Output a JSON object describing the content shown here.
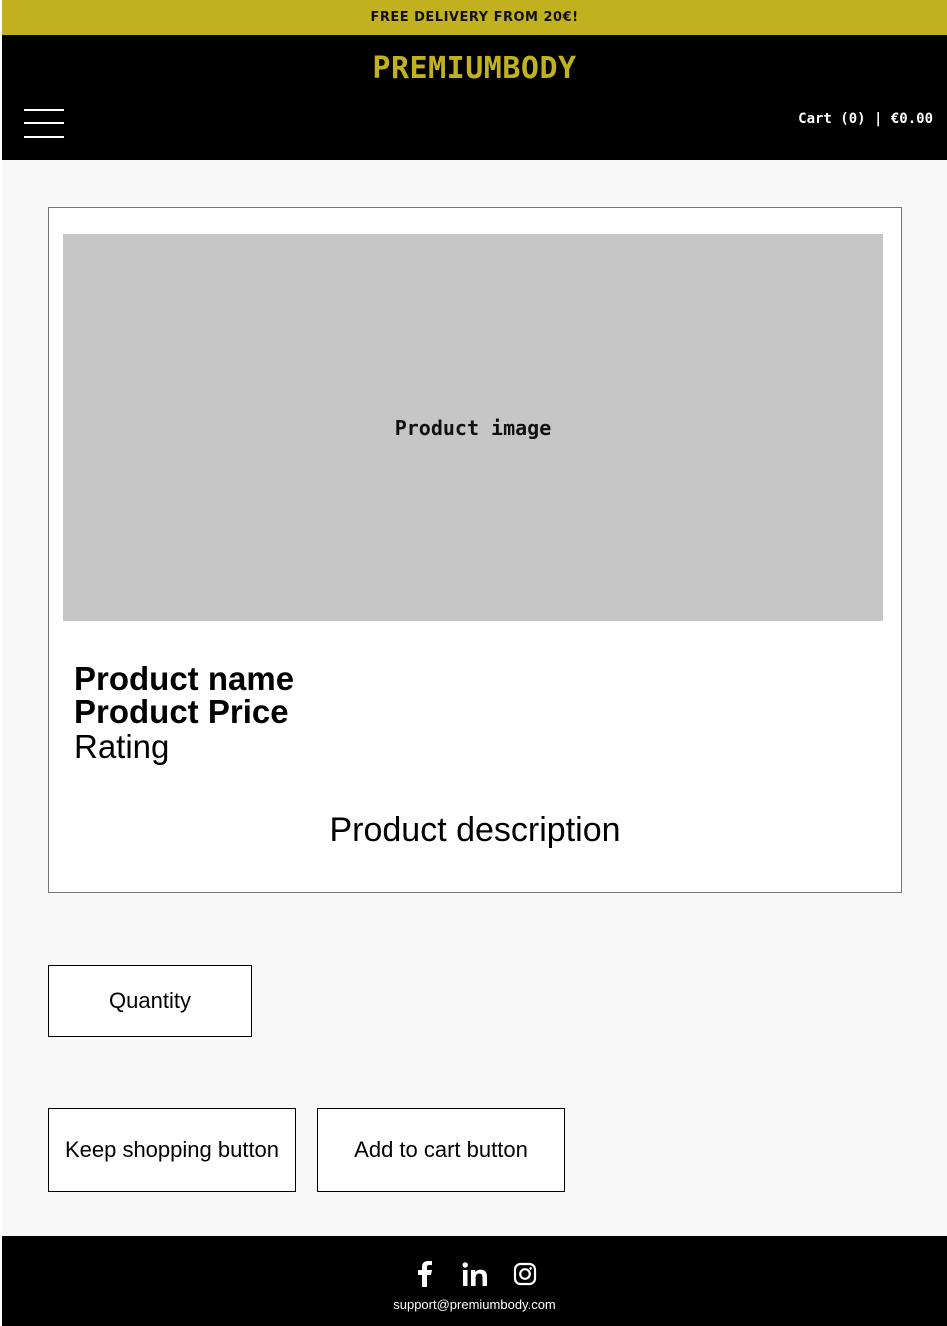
{
  "announcement": {
    "text": "FREE DELIVERY FROM 20€!"
  },
  "header": {
    "logo": "PREMIUMBODY",
    "menu_icon": "hamburger-menu-icon",
    "cart_label": "Cart (0) | €0.00"
  },
  "product": {
    "image_placeholder": "Product image",
    "name": "Product name",
    "price": "Product Price",
    "rating": "Rating",
    "description": "Product description"
  },
  "controls": {
    "quantity_label": "Quantity",
    "keep_shopping_label": "Keep shopping button",
    "add_to_cart_label": "Add to cart button"
  },
  "footer": {
    "social_icons": [
      "facebook-icon",
      "linkedin-icon",
      "instagram-icon"
    ],
    "email": "support@premiumbody.com"
  },
  "colors": {
    "accent": "#c1b11f",
    "header_bg": "#000000",
    "page_bg": "#f8f8f8",
    "image_placeholder_bg": "#c6c6c6"
  }
}
